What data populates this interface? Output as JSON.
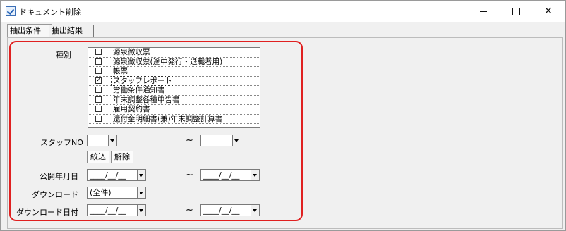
{
  "window": {
    "title": "ドキュメント削除",
    "buttons": {
      "minimize": "—",
      "maximize": "☐",
      "close": "✕"
    }
  },
  "tabs": [
    {
      "label": "抽出条件"
    },
    {
      "label": "抽出結果"
    }
  ],
  "form": {
    "type_label": "種別",
    "types": [
      {
        "label": "源泉徴収票",
        "checked": false
      },
      {
        "label": "源泉徴収票(途中発行・退職者用)",
        "checked": false
      },
      {
        "label": "帳票",
        "checked": false
      },
      {
        "label": "スタッフレポート",
        "checked": true
      },
      {
        "label": "労働条件通知書",
        "checked": false
      },
      {
        "label": "年末調整各種申告書",
        "checked": false
      },
      {
        "label": "雇用契約書",
        "checked": false
      },
      {
        "label": "還付金明細書(兼)年末調整計算書",
        "checked": false
      }
    ],
    "staff_no_label": "スタッフNO",
    "staff_no_from": "",
    "staff_no_to": "",
    "tilde": "~",
    "narrow_button": "絞込",
    "release_button": "解除",
    "publish_date_label": "公開年月日",
    "publish_from": "____/__/__",
    "publish_to": "____/__/__",
    "download_label": "ダウンロード",
    "download_value": "(全件)",
    "download_date_label": "ダウンロード日付",
    "download_from": "____/__/__",
    "download_to": "____/__/__"
  }
}
